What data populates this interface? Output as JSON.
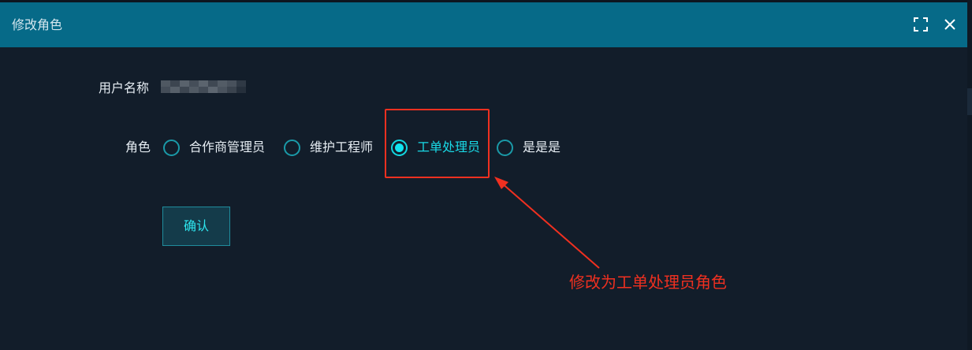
{
  "dialog": {
    "title": "修改角色",
    "fullscreen_icon": "fullscreen-icon",
    "close_icon": "close-icon"
  },
  "form": {
    "user_label": "用户名称",
    "user_value_obscured": true,
    "role_label": "角色",
    "role_options": [
      {
        "label": "合作商管理员",
        "checked": false
      },
      {
        "label": "维护工程师",
        "checked": false
      },
      {
        "label": "工单处理员",
        "checked": true
      },
      {
        "label": "是是是",
        "checked": false
      }
    ],
    "selected_role": "工单处理员",
    "confirm_label": "确认"
  },
  "annotation": {
    "text": "修改为工单处理员角色",
    "color": "#f03020"
  },
  "colors": {
    "header": "#066a88",
    "background": "#121d2a",
    "accent": "#12e4f0",
    "radio_border": "#1a9aa8",
    "button_bg": "#143b4a"
  }
}
